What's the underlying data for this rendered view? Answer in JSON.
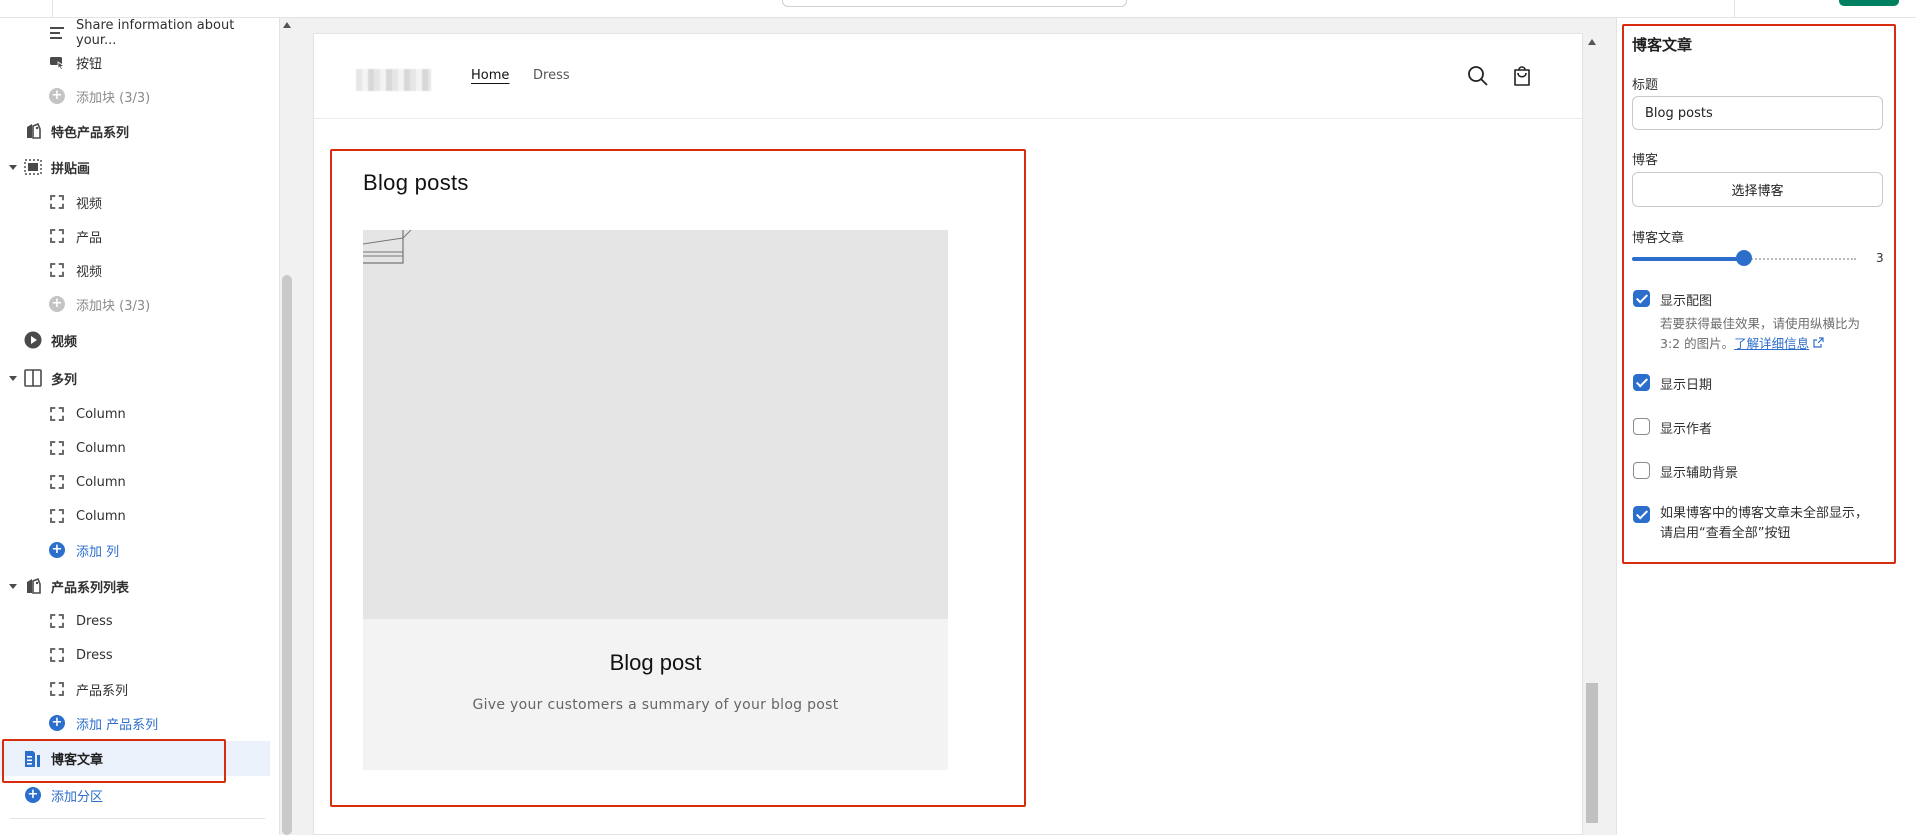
{
  "sidebar": {
    "rows": {
      "share_info": "Share information about your...",
      "button_block": "按钮",
      "add_block_1": "添加块 (3/3)",
      "featured_collection": "特色产品系列",
      "collage": "拼贴画",
      "collage_video1": "视频",
      "collage_product": "产品",
      "collage_video2": "视频",
      "add_block_2": "添加块 (3/3)",
      "video": "视频",
      "multicolumn": "多列",
      "col1": "Column",
      "col2": "Column",
      "col3": "Column",
      "col4": "Column",
      "add_column": "添加 列",
      "collection_list": "产品系列列表",
      "cl_dress1": "Dress",
      "cl_dress2": "Dress",
      "cl_collection": "产品系列",
      "add_collection": "添加 产品系列",
      "blog_posts": "博客文章",
      "add_section": "添加分区"
    }
  },
  "preview": {
    "nav": {
      "home": "Home",
      "dress": "Dress"
    },
    "section_title": "Blog posts",
    "card": {
      "title": "Blog post",
      "summary": "Give your customers a summary of your blog post"
    }
  },
  "settings": {
    "panel_title": "博客文章",
    "heading_label": "标题",
    "heading_value": "Blog posts",
    "blog_label": "博客",
    "select_blog_button": "选择博客",
    "posts_label": "博客文章",
    "posts_count": "3",
    "posts_fraction": 0.5,
    "show_image": {
      "label": "显示配图",
      "checked": true
    },
    "help_text": "若要获得最佳效果，请使用纵横比为 3:2 的图片。",
    "help_link": "了解详细信息",
    "show_date": {
      "label": "显示日期",
      "checked": true
    },
    "show_author": {
      "label": "显示作者",
      "checked": false
    },
    "show_bg": {
      "label": "显示辅助背景",
      "checked": false
    },
    "show_view_all": {
      "label": "如果博客中的博客文章未全部显示，请启用“查看全部”按钮",
      "checked": true
    }
  },
  "colors": {
    "accent": "#2c6ecb",
    "highlight_box": "#d72c0d",
    "admin_green": "#008060"
  },
  "icons": {
    "text_block": "text-lines-icon",
    "button_block": "button-icon",
    "featured_collection": "tag-icon",
    "collage": "collage-icon",
    "video": "play-icon",
    "multicolumn": "columns-icon",
    "block": "dashed-bracket-icon",
    "blog": "blog-icon",
    "search": "search-icon",
    "cart": "cart-icon",
    "external": "external-link-icon"
  }
}
